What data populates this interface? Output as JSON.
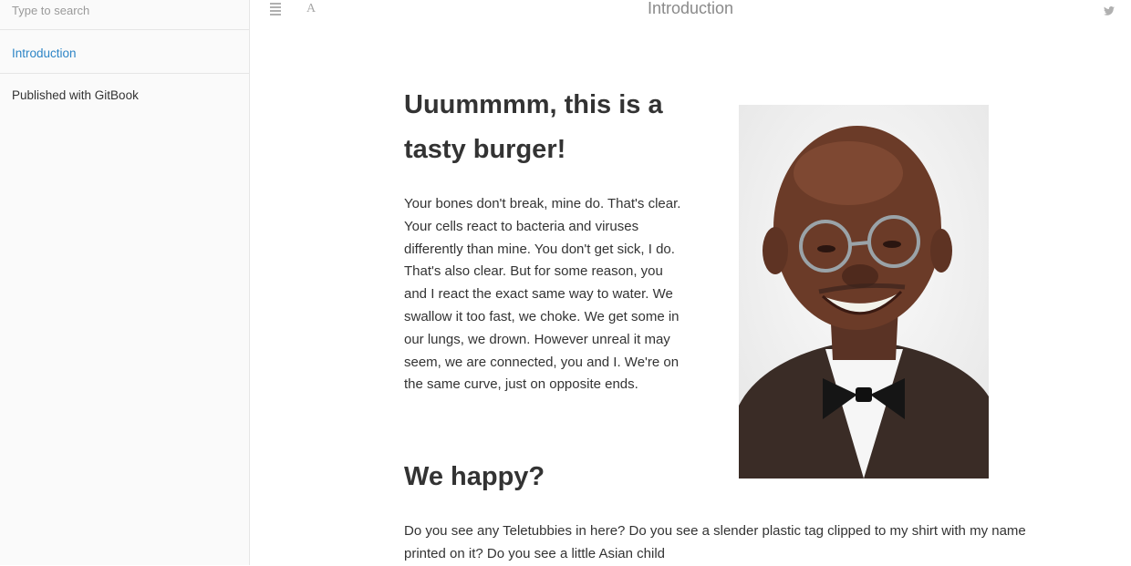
{
  "sidebar": {
    "search_placeholder": "Type to search",
    "items": [
      {
        "label": "Introduction",
        "active": true
      }
    ],
    "published": "Published with GitBook"
  },
  "header": {
    "title": "Introduction",
    "icons": [
      "menu-icon",
      "font-settings-icon",
      "twitter-icon"
    ]
  },
  "article": {
    "heading1": "Uuummmm, this is a tasty burger!",
    "paragraph1": "Your bones don't break, mine do. That's clear. Your cells react to bacteria and viruses differently than mine. You don't get sick, I do. That's also clear. But for some reason, you and I react the exact same way to water. We swallow it too fast, we choke. We get some in our lungs, we drown. However unreal it may seem, we are connected, you and I. We're on the same curve, just on opposite ends.",
    "heading2": "We happy?",
    "paragraph2": "Do you see any Teletubbies in here? Do you see a slender plastic tag clipped to my shirt with my name printed on it? Do you see a little Asian child"
  },
  "colors": {
    "accent": "#2d85c6",
    "sidebar_bg": "#fafafa",
    "text": "#333333"
  }
}
